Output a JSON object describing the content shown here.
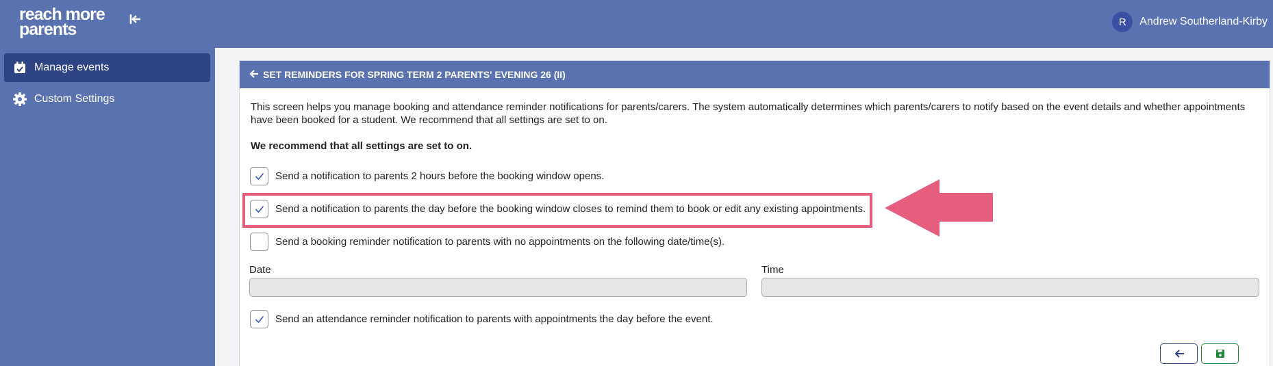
{
  "app": {
    "logo_line1": "reach more",
    "logo_line2": "parents",
    "collapse_icon": "collapse-left-icon"
  },
  "user": {
    "initial": "R",
    "name": "Andrew Southerland-Kirby"
  },
  "sidebar": {
    "items": [
      {
        "label": "Manage events",
        "icon": "calendar-check-icon",
        "active": true
      },
      {
        "label": "Custom Settings",
        "icon": "gear-icon",
        "active": false
      }
    ]
  },
  "page": {
    "title": "SET REMINDERS FOR SPRING TERM 2 PARENTS' EVENING 26 (II)",
    "intro": "This screen helps you manage booking and attendance reminder notifications for parents/carers. The system automatically determines which parents/carers to notify based on the event details and whether appointments have been booked for a student. We recommend that all settings are set to on.",
    "recommend": "We recommend that all settings are set to on.",
    "options": [
      {
        "label": "Send a notification to parents 2 hours before the booking window opens.",
        "checked": true
      },
      {
        "label": "Send a notification to parents the day before the booking window closes to remind them to book or edit any existing appointments.",
        "checked": true
      },
      {
        "label": "Send a booking reminder notification to parents with no appointments on the following date/time(s).",
        "checked": false
      },
      {
        "label": "Send an attendance reminder notification to parents with appointments the day before the event.",
        "checked": true
      }
    ],
    "date_label": "Date",
    "time_label": "Time",
    "date_value": "",
    "time_value": ""
  },
  "colors": {
    "header": "#5b72b0",
    "active_nav": "#2e4384",
    "highlight": "#e55e7d",
    "save": "#1f8a3b"
  }
}
